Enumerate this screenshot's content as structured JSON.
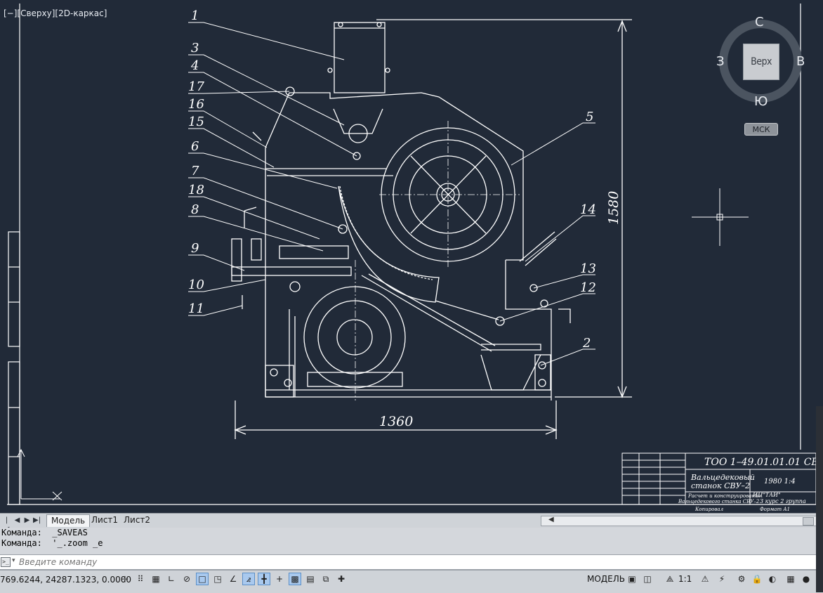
{
  "viewport": {
    "label": "[−][Сверху][2D-каркас]",
    "viewcube": {
      "north": "С",
      "south": "Ю",
      "east": "В",
      "west": "З",
      "face": "Верх",
      "ucs": "МСК"
    }
  },
  "drawing": {
    "leaders": [
      "1",
      "3",
      "4",
      "17",
      "16",
      "15",
      "6",
      "7",
      "18",
      "8",
      "9",
      "10",
      "11",
      "5",
      "14",
      "13",
      "12",
      "2"
    ],
    "dim_width": "1360",
    "dim_height": "1580",
    "title_block": {
      "code": "ТОО 1–49.01.01.01 СБ",
      "name_line1": "Вальцедековый",
      "name_line2": "станок СВУ–2",
      "mass_scale": "1980  1:4",
      "org_line1": "ИЦ\"ТАИ\"",
      "org_line2": "3 курс 2 группа",
      "desc_line1": "Расчет и конструирование",
      "desc_line2": "Вальцедекового станка СВУ–2",
      "copied": "Копировал",
      "format": "Формат А1"
    }
  },
  "tabs": {
    "items": [
      "Модель",
      "Лист1",
      "Лист2"
    ],
    "active": "Модель"
  },
  "command": {
    "history": [
      "Команда:  _SAVEAS",
      "Команда:  '_.zoom _e"
    ],
    "placeholder": "Введите команду"
  },
  "status": {
    "coords": "769.6244, 24287.1323, 0.0000",
    "model": "МОДЕЛЬ",
    "scale": "1:1"
  },
  "colors": {
    "background": "#212a38",
    "lines": "#ffffff",
    "ui_panel": "#cfd3d8"
  }
}
